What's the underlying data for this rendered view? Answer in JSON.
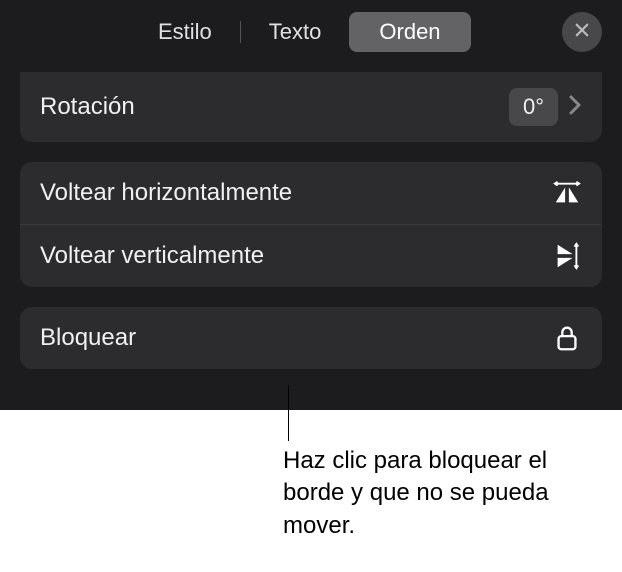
{
  "tabs": {
    "style": "Estilo",
    "text": "Texto",
    "arrange": "Orden"
  },
  "rotation": {
    "label": "Rotación",
    "value": "0°"
  },
  "flip": {
    "horizontal": "Voltear horizontalmente",
    "vertical": "Voltear verticalmente"
  },
  "lock": {
    "label": "Bloquear"
  },
  "callout": {
    "text": "Haz clic para bloquear el borde y que no se pueda mover."
  }
}
